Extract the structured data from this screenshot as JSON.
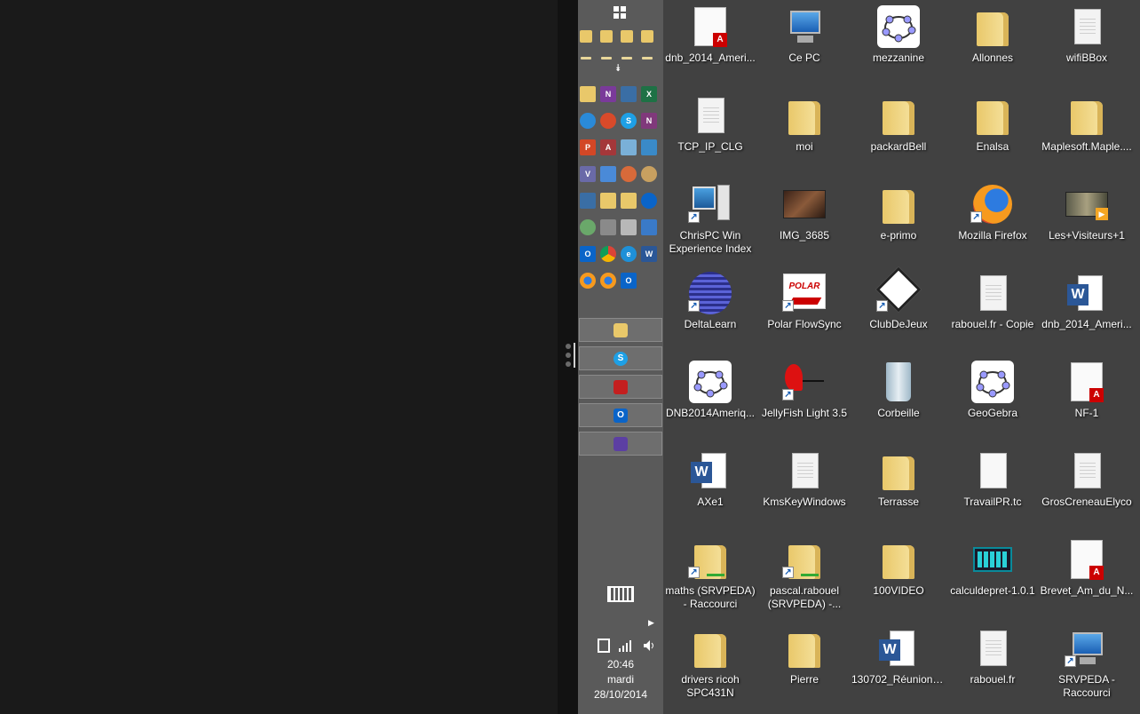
{
  "taskbar": {
    "start_icon": "windows-logo-icon",
    "overflow_icon": "double-chevron-down-icon",
    "open_windows": [
      {
        "name": "file-explorer",
        "icon": "folder-icon",
        "color": "#e9c86a"
      },
      {
        "name": "skype",
        "icon": "skype-icon",
        "color": "#1ea0e6"
      },
      {
        "name": "ccleaner",
        "icon": "ccleaner-icon",
        "color": "#c41f1f"
      },
      {
        "name": "outlook",
        "icon": "outlook-icon",
        "color": "#0a64c8"
      },
      {
        "name": "calendar",
        "icon": "calendar-icon",
        "color": "#5c3fa3"
      }
    ],
    "tray": {
      "time": "20:46",
      "day": "mardi",
      "date": "28/10/2014"
    }
  },
  "desktop": {
    "icons": [
      {
        "label": "dnb_2014_Ameri...",
        "icon": "pdf-document-icon"
      },
      {
        "label": "Ce PC",
        "icon": "computer-icon"
      },
      {
        "label": "mezzanine",
        "icon": "geogebra-icon"
      },
      {
        "label": "Allonnes",
        "icon": "folder-icon"
      },
      {
        "label": "wifiBBox",
        "icon": "text-file-icon"
      },
      {
        "label": "TCP_IP_CLG",
        "icon": "text-file-icon"
      },
      {
        "label": "moi",
        "icon": "folder-icon"
      },
      {
        "label": "packardBell",
        "icon": "folder-icon"
      },
      {
        "label": "Enalsa",
        "icon": "folder-icon"
      },
      {
        "label": "Maplesoft.Maple....",
        "icon": "folder-icon"
      },
      {
        "label": "ChrisPC Win Experience Index",
        "icon": "computer-tower-icon"
      },
      {
        "label": "IMG_3685",
        "icon": "photo-icon"
      },
      {
        "label": "e-primo",
        "icon": "folder-icon"
      },
      {
        "label": "Mozilla Firefox",
        "icon": "firefox-icon"
      },
      {
        "label": "Les+Visiteurs+1",
        "icon": "video-icon"
      },
      {
        "label": "DeltaLearn",
        "icon": "eclipse-icon"
      },
      {
        "label": "Polar FlowSync",
        "icon": "polar-icon"
      },
      {
        "label": "ClubDeJeux",
        "icon": "clubdejeux-icon"
      },
      {
        "label": "rabouel.fr - Copie",
        "icon": "text-file-icon"
      },
      {
        "label": "dnb_2014_Ameri...",
        "icon": "word-document-icon"
      },
      {
        "label": "DNB2014Ameriq...",
        "icon": "geogebra-icon"
      },
      {
        "label": "JellyFish Light 3.5",
        "icon": "jellyfish-icon"
      },
      {
        "label": "Corbeille",
        "icon": "recycle-bin-icon"
      },
      {
        "label": "GeoGebra",
        "icon": "geogebra-icon"
      },
      {
        "label": "NF-1",
        "icon": "pdf-document-icon"
      },
      {
        "label": "AXe1",
        "icon": "word-document-icon"
      },
      {
        "label": "KmsKeyWindows",
        "icon": "text-file-icon"
      },
      {
        "label": "Terrasse",
        "icon": "folder-icon"
      },
      {
        "label": "TravailPR.tc",
        "icon": "blank-file-icon"
      },
      {
        "label": "GrosCreneauElyco",
        "icon": "text-file-icon"
      },
      {
        "label": "maths (SRVPEDA) - Raccourci",
        "icon": "network-folder-icon"
      },
      {
        "label": "pascal.rabouel (SRVPEDA) -...",
        "icon": "network-folder-icon"
      },
      {
        "label": "100VIDEO",
        "icon": "folder-icon"
      },
      {
        "label": "calculdepret-1.0.1",
        "icon": "calculator-icon"
      },
      {
        "label": "Brevet_Am_du_N...",
        "icon": "pdf-document-icon"
      },
      {
        "label": "drivers ricoh SPC431N",
        "icon": "folder-icon"
      },
      {
        "label": "Pierre",
        "icon": "folder-icon"
      },
      {
        "label": "130702_RéunionP...",
        "icon": "word-document-icon"
      },
      {
        "label": "rabouel.fr",
        "icon": "text-file-icon"
      },
      {
        "label": "SRVPEDA - Raccourci",
        "icon": "computer-icon"
      }
    ]
  }
}
